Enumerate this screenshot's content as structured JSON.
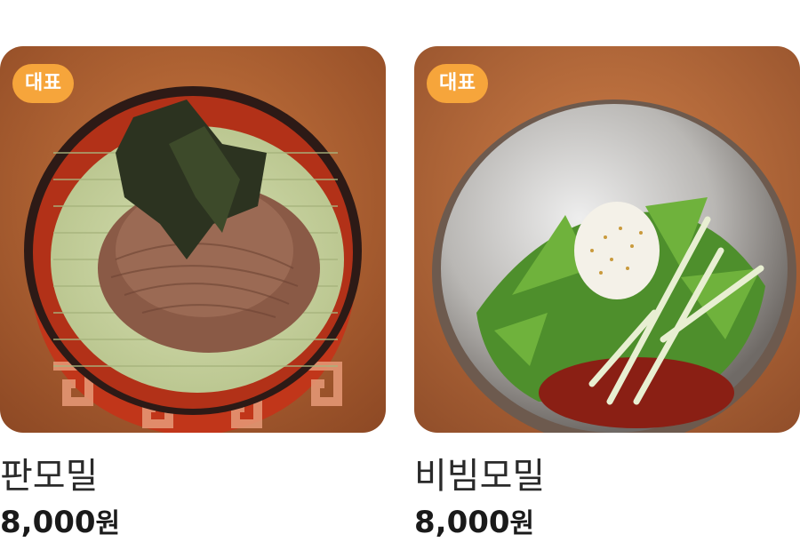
{
  "menu": {
    "items": [
      {
        "badge": "대표",
        "name": "판모밀",
        "price": "8,000",
        "currency": "원",
        "image_icon": "cold-soba-photo"
      },
      {
        "badge": "대표",
        "name": "비빔모밀",
        "price": "8,000",
        "currency": "원",
        "image_icon": "bibim-soba-photo"
      }
    ]
  },
  "colors": {
    "badge_bg": "#f6a53b",
    "text_primary": "#2a2a2a",
    "background": "#ffffff"
  }
}
